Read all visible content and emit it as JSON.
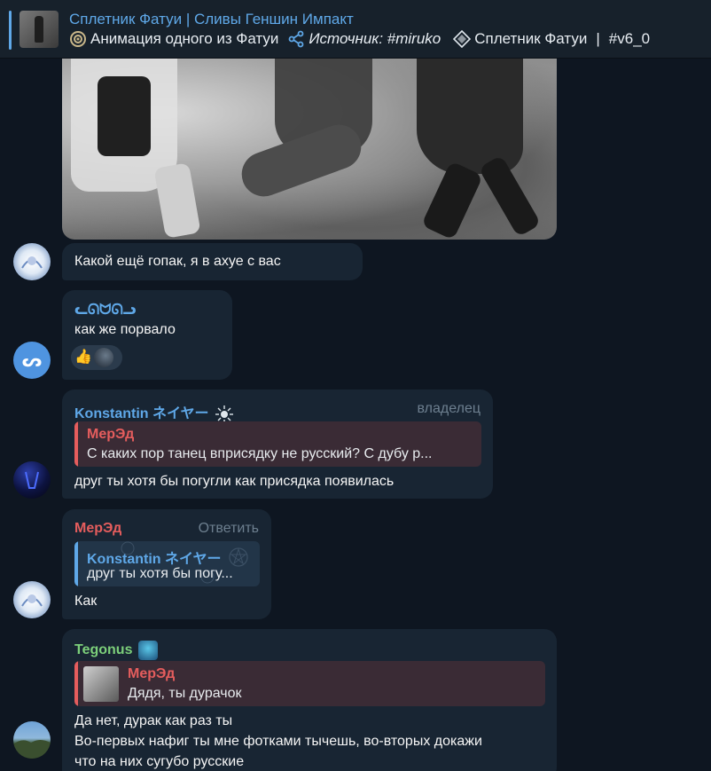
{
  "pinned": {
    "title": "Сплетник Фатуи | Сливы Геншин Импакт",
    "sub_part1": "Анимация одного из Фатуи",
    "sub_part2": "Источник: #miruko",
    "sub_part3": "Сплетник Фатуи",
    "sub_sep": "|",
    "sub_part4": "#v6_0"
  },
  "messages": [
    {
      "text": "Какой ещё гопак, я в ахуе с вас"
    },
    {
      "sender": "ᓚᘏᗢᘏᓗ",
      "text": "как же порвало",
      "avatar_letter": "ᔕ",
      "reaction": "👍"
    },
    {
      "sender": "Konstantin ネイヤー",
      "role": "владелец",
      "reply_name": "МерЭд",
      "reply_text": "С каких пор танец вприсядку не русский? С дубу р...",
      "text": "друг ты хотя бы погугли как присядка появилась"
    },
    {
      "sender": "МерЭд",
      "action": "Ответить",
      "reply_name": "Konstantin ネイヤー",
      "reply_text": "друг ты хотя бы погу...",
      "text": "Как"
    },
    {
      "sender": "Tegonus",
      "reply_name": "МерЭд",
      "reply_text": "Дядя, ты дурачок",
      "text_line1": "Да нет, дурак как раз ты",
      "text_line2": "Во-первых нафиг ты мне фотками тычешь, во-вторых докажи",
      "text_line3": "что на них сугубо русские"
    }
  ],
  "colors": {
    "bg": "#0e1621",
    "bubble": "#182533",
    "accent_blue": "#5fa8e8",
    "red_name": "#e55d5d",
    "green_name": "#7ccf7a",
    "meta": "#6d7f8f"
  }
}
